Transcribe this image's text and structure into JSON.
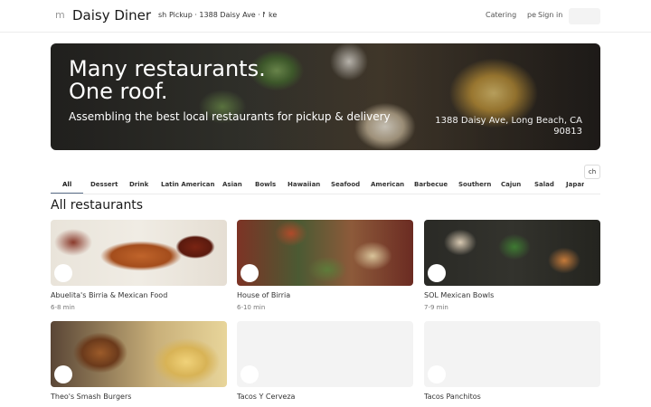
{
  "header": {
    "menu_glyph": "m",
    "brand": "Daisy Diner",
    "location_prefix": "sh",
    "location_text": "Pickup · 1388 Daisy Ave · Now",
    "location_suffix": "ke",
    "catering_label": "Catering",
    "person_glyph": "pe",
    "signin_label": "Sign in"
  },
  "hero": {
    "title_line1": "Many restaurants.",
    "title_line2": "One roof.",
    "subtitle": "Assembling the best local restaurants for pickup & delivery",
    "address": "1388 Daisy Ave, Long Beach, CA 90813"
  },
  "tabs": [
    "All",
    "Dessert",
    "Drink",
    "Latin American",
    "Asian",
    "Bowls",
    "Hawaiian",
    "Seafood",
    "American",
    "Barbecue",
    "Southern",
    "Cajun",
    "Salad",
    "Japan"
  ],
  "tabs_scroll_glyph": "ch",
  "section_title": "All restaurants",
  "restaurants": [
    {
      "name": "Abuelita's Birria & Mexican Food",
      "time": "6-8 min"
    },
    {
      "name": "House of Birria",
      "time": "6-10 min"
    },
    {
      "name": "SOL Mexican Bowls",
      "time": "7-9 min"
    },
    {
      "name": "Theo's Smash Burgers",
      "time": ""
    },
    {
      "name": "Tacos Y Cerveza",
      "time": ""
    },
    {
      "name": "Tacos Panchitos",
      "time": ""
    }
  ]
}
